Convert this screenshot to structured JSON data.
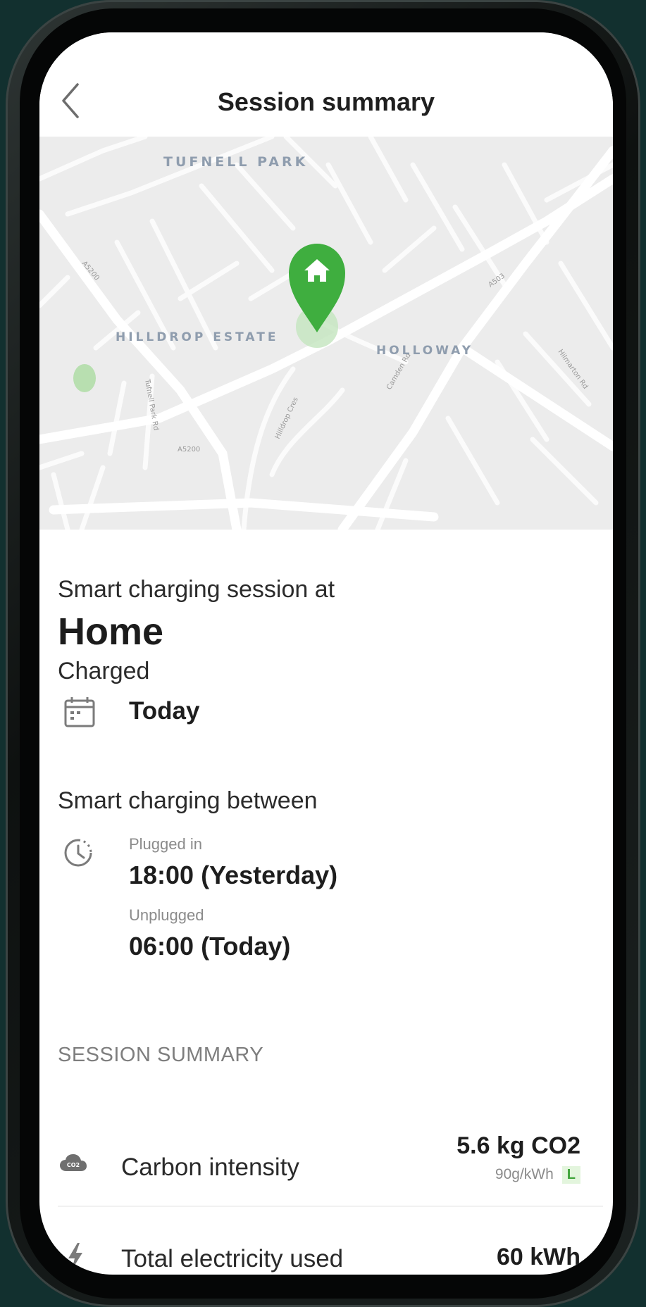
{
  "header": {
    "title": "Session summary"
  },
  "map": {
    "areas": [
      "TUFNELL PARK",
      "HILLDROP ESTATE",
      "HOLLOWAY"
    ],
    "roads": [
      "A5200",
      "A503",
      "A5200",
      "Camden Rd",
      "Hilldrop Cres",
      "Hilmarton Rd",
      "Tufnell Park Rd"
    ],
    "pin_color": "#3fae3f"
  },
  "session": {
    "intro": "Smart charging session at",
    "location": "Home",
    "charged_label": "Charged",
    "charged_date": "Today",
    "between_label": "Smart charging between",
    "plugged_in_label": "Plugged in",
    "plugged_in_time": "18:00 (Yesterday)",
    "unplugged_label": "Unplugged",
    "unplugged_time": "06:00 (Today)"
  },
  "summary": {
    "header": "SESSION SUMMARY",
    "carbon": {
      "label": "Carbon intensity",
      "value": "5.6 kg CO2",
      "sub_value": "90g/kWh",
      "badge": "L",
      "icon_text": "CO2"
    },
    "electricity": {
      "label": "Total electricity used",
      "value": "60 kWh"
    }
  }
}
